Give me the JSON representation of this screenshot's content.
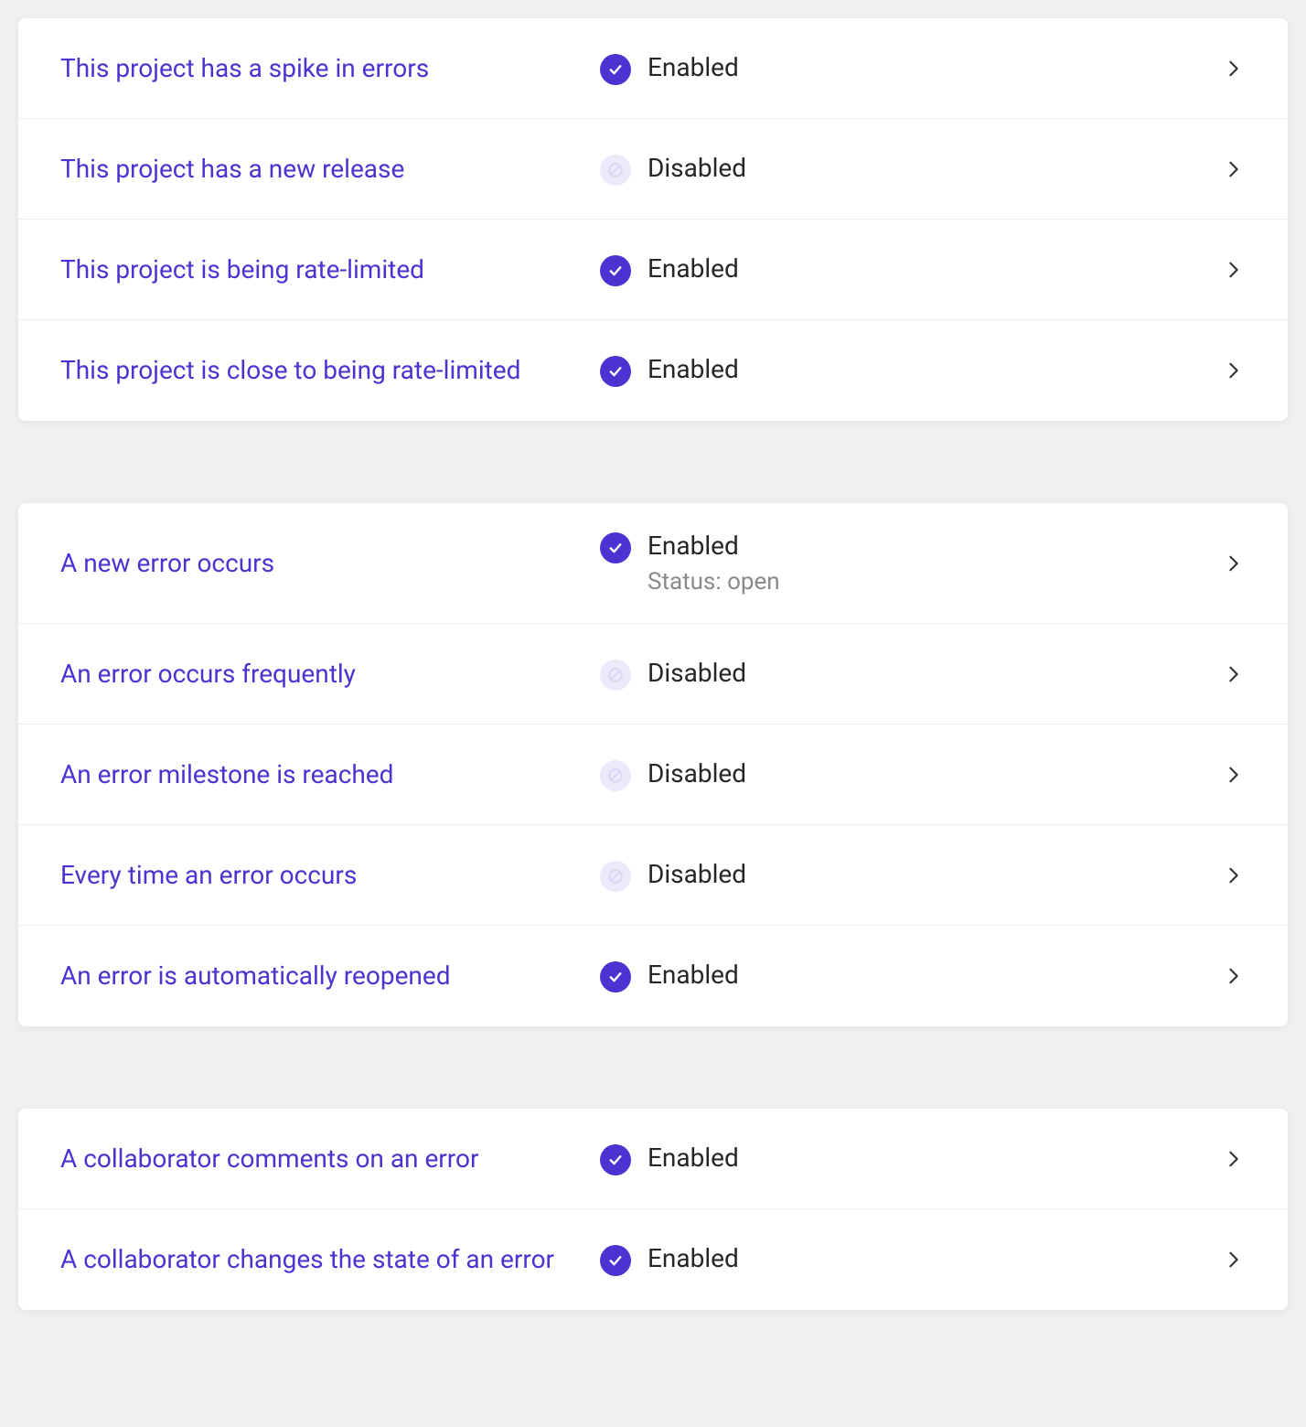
{
  "status_labels": {
    "enabled": "Enabled",
    "disabled": "Disabled"
  },
  "groups": [
    {
      "items": [
        {
          "name": "spike-in-errors",
          "title": "This project has a spike in errors",
          "enabled": true
        },
        {
          "name": "new-release",
          "title": "This project has a new release",
          "enabled": false
        },
        {
          "name": "rate-limited",
          "title": "This project is being rate-limited",
          "enabled": true
        },
        {
          "name": "close-rate-limited",
          "title": "This project is close to being rate-limited",
          "enabled": true
        }
      ]
    },
    {
      "items": [
        {
          "name": "new-error-occurs",
          "title": "A new error occurs",
          "enabled": true,
          "subtext": "Status: open"
        },
        {
          "name": "error-occurs-frequently",
          "title": "An error occurs frequently",
          "enabled": false
        },
        {
          "name": "error-milestone",
          "title": "An error milestone is reached",
          "enabled": false
        },
        {
          "name": "every-time-error",
          "title": "Every time an error occurs",
          "enabled": false
        },
        {
          "name": "error-reopened",
          "title": "An error is automatically reopened",
          "enabled": true
        }
      ]
    },
    {
      "items": [
        {
          "name": "collaborator-comments",
          "title": "A collaborator comments on an error",
          "enabled": true
        },
        {
          "name": "collaborator-changes-state",
          "title": "A collaborator changes the state of an error",
          "enabled": true
        }
      ]
    }
  ]
}
